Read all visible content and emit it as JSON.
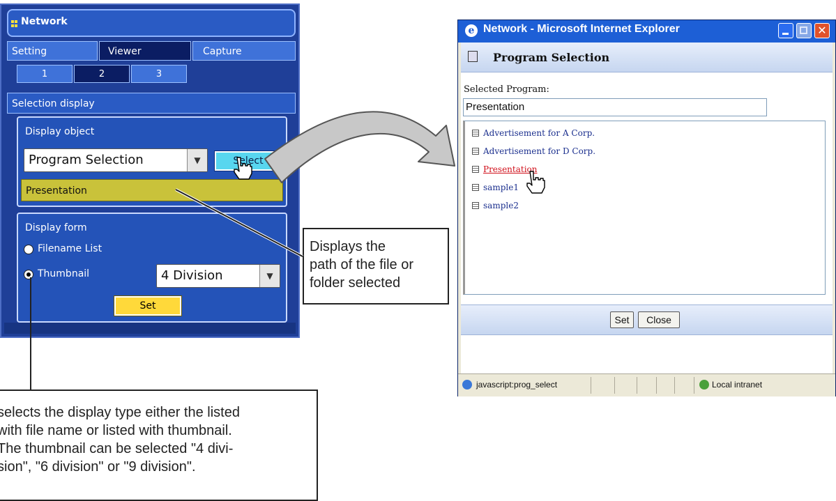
{
  "panel": {
    "title": "Network",
    "tabs": [
      "Setting",
      "Viewer",
      "Capture"
    ],
    "subtabs": [
      "1",
      "2",
      "3"
    ],
    "section_title": "Selection display",
    "display_object_label": "Display object",
    "program_dropdown": "Program Selection",
    "select_button": "Select",
    "path_value": "Presentation",
    "display_form_label": "Display form",
    "radio_filename": "Filename List",
    "radio_thumbnail": "Thumbnail",
    "division_dropdown": "4 Division",
    "set_button": "Set"
  },
  "callouts": {
    "path_note": [
      "Displays the",
      "path of the file or",
      "folder selected"
    ],
    "display_type_note": [
      "selects the display type either the listed",
      "with file name or listed with thumbnail.",
      "The thumbnail can be selected \"4 divi-",
      "sion\", \"6 division\" or \"9 division\"."
    ]
  },
  "ie": {
    "window_title": "Network - Microsoft Internet Explorer",
    "header_title": "Program Selection",
    "selected_label": "Selected Program:",
    "selected_value": "Presentation",
    "items": [
      "Advertisement for A Corp.",
      "Advertisement for D Corp.",
      "Presentation",
      "sample1",
      "sample2"
    ],
    "set_button": "Set",
    "close_button": "Close",
    "status_text": "javascript:prog_select",
    "zone_text": "Local intranet"
  }
}
